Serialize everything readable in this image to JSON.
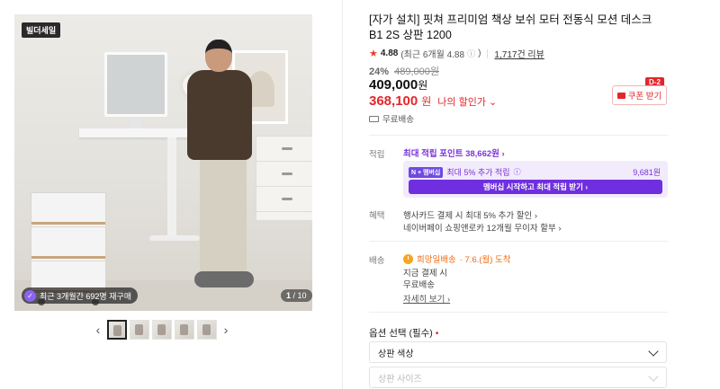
{
  "gallery": {
    "brand_badge": "빌더세일",
    "repurchase_text": "최근 3개월간 692명 재구매",
    "page_current": "1",
    "page_total": "/ 10",
    "prev_arrow": "‹",
    "next_arrow": "›"
  },
  "product": {
    "title": "[자가 설치] 핏쳐 프리미엄 책상 보쉬 모터 전동식 모션 데스크 B1 2S 상판 1200",
    "rating": "4.88",
    "rating_recent": "(최근 6개월 4.88",
    "rating_recent_close": ")",
    "review_count": "1,717건 리뷰",
    "discount_pct": "24%",
    "original_price": "489,000원",
    "price": "409,000",
    "price_won": "원",
    "sale_price": "368,100",
    "sale_won": "원",
    "sale_label": "나의 할인가 ⌄",
    "coupon_label": "쿠폰 받기",
    "coupon_dday": "D-2",
    "shipping": "무료배송"
  },
  "points": {
    "label": "적립",
    "max_link": "최대 적립 포인트 38,662원 ›",
    "member_tag": "N + 멤버십",
    "member_text": "최대 5% 추가 적립",
    "member_amount": "9,681원",
    "member_button": "멤버십 시작하고 최대 적립 받기 ›"
  },
  "benefits": {
    "label": "혜택",
    "items": [
      "행사카드 결제 시 최대 5% 추가 할인 ›",
      "네이버페이 쇼핑앤로카 12개월 무이자 할부 ›"
    ]
  },
  "delivery": {
    "label": "배송",
    "badge": "희망일배송",
    "date": "· 7.6.(월) 도착",
    "lines": [
      "지금 결제 시",
      "무료배송"
    ],
    "detail_link": "자세히 보기 ›"
  },
  "options": {
    "label": "옵션 선택 (필수)",
    "required_mark": "•",
    "select_1": "상판 색상",
    "select_2": "상판 사이즈"
  },
  "colors": {
    "accent_red": "#e4262b",
    "accent_purple": "#7b34d6",
    "membership_button": "#6f2fe0"
  }
}
